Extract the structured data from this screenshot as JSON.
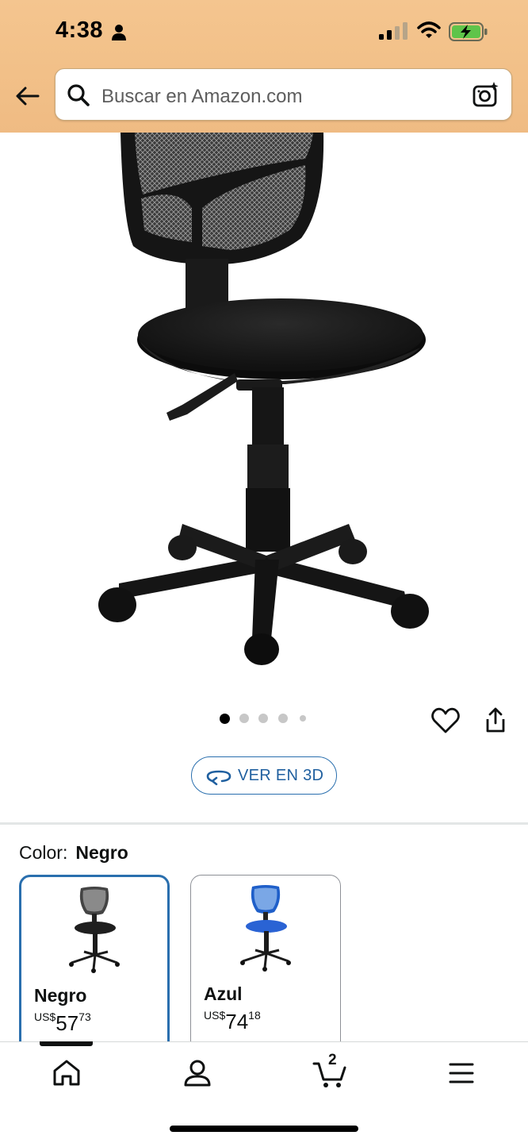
{
  "status_bar": {
    "time": "4:38"
  },
  "search": {
    "placeholder": "Buscar en Amazon.com"
  },
  "product": {
    "image_name": "office-chair-black",
    "carousel": {
      "count": 5,
      "active_index": 0
    },
    "view_3d_label": "VER EN 3D"
  },
  "variant": {
    "label": "Color:",
    "selected": "Negro",
    "options": [
      {
        "name": "Negro",
        "currency": "US$",
        "price_whole": "57",
        "price_frac": "73",
        "color": "#222222"
      },
      {
        "name": "Azul",
        "currency": "US$",
        "price_whole": "74",
        "price_frac": "18",
        "color": "#2f6fd6"
      }
    ]
  },
  "nav": {
    "cart_count": "2",
    "items": [
      "home-icon",
      "account-icon",
      "cart-icon",
      "menu-icon"
    ]
  },
  "colors": {
    "header_bg": "#f2c088",
    "accent_blue": "#2a6fae"
  }
}
